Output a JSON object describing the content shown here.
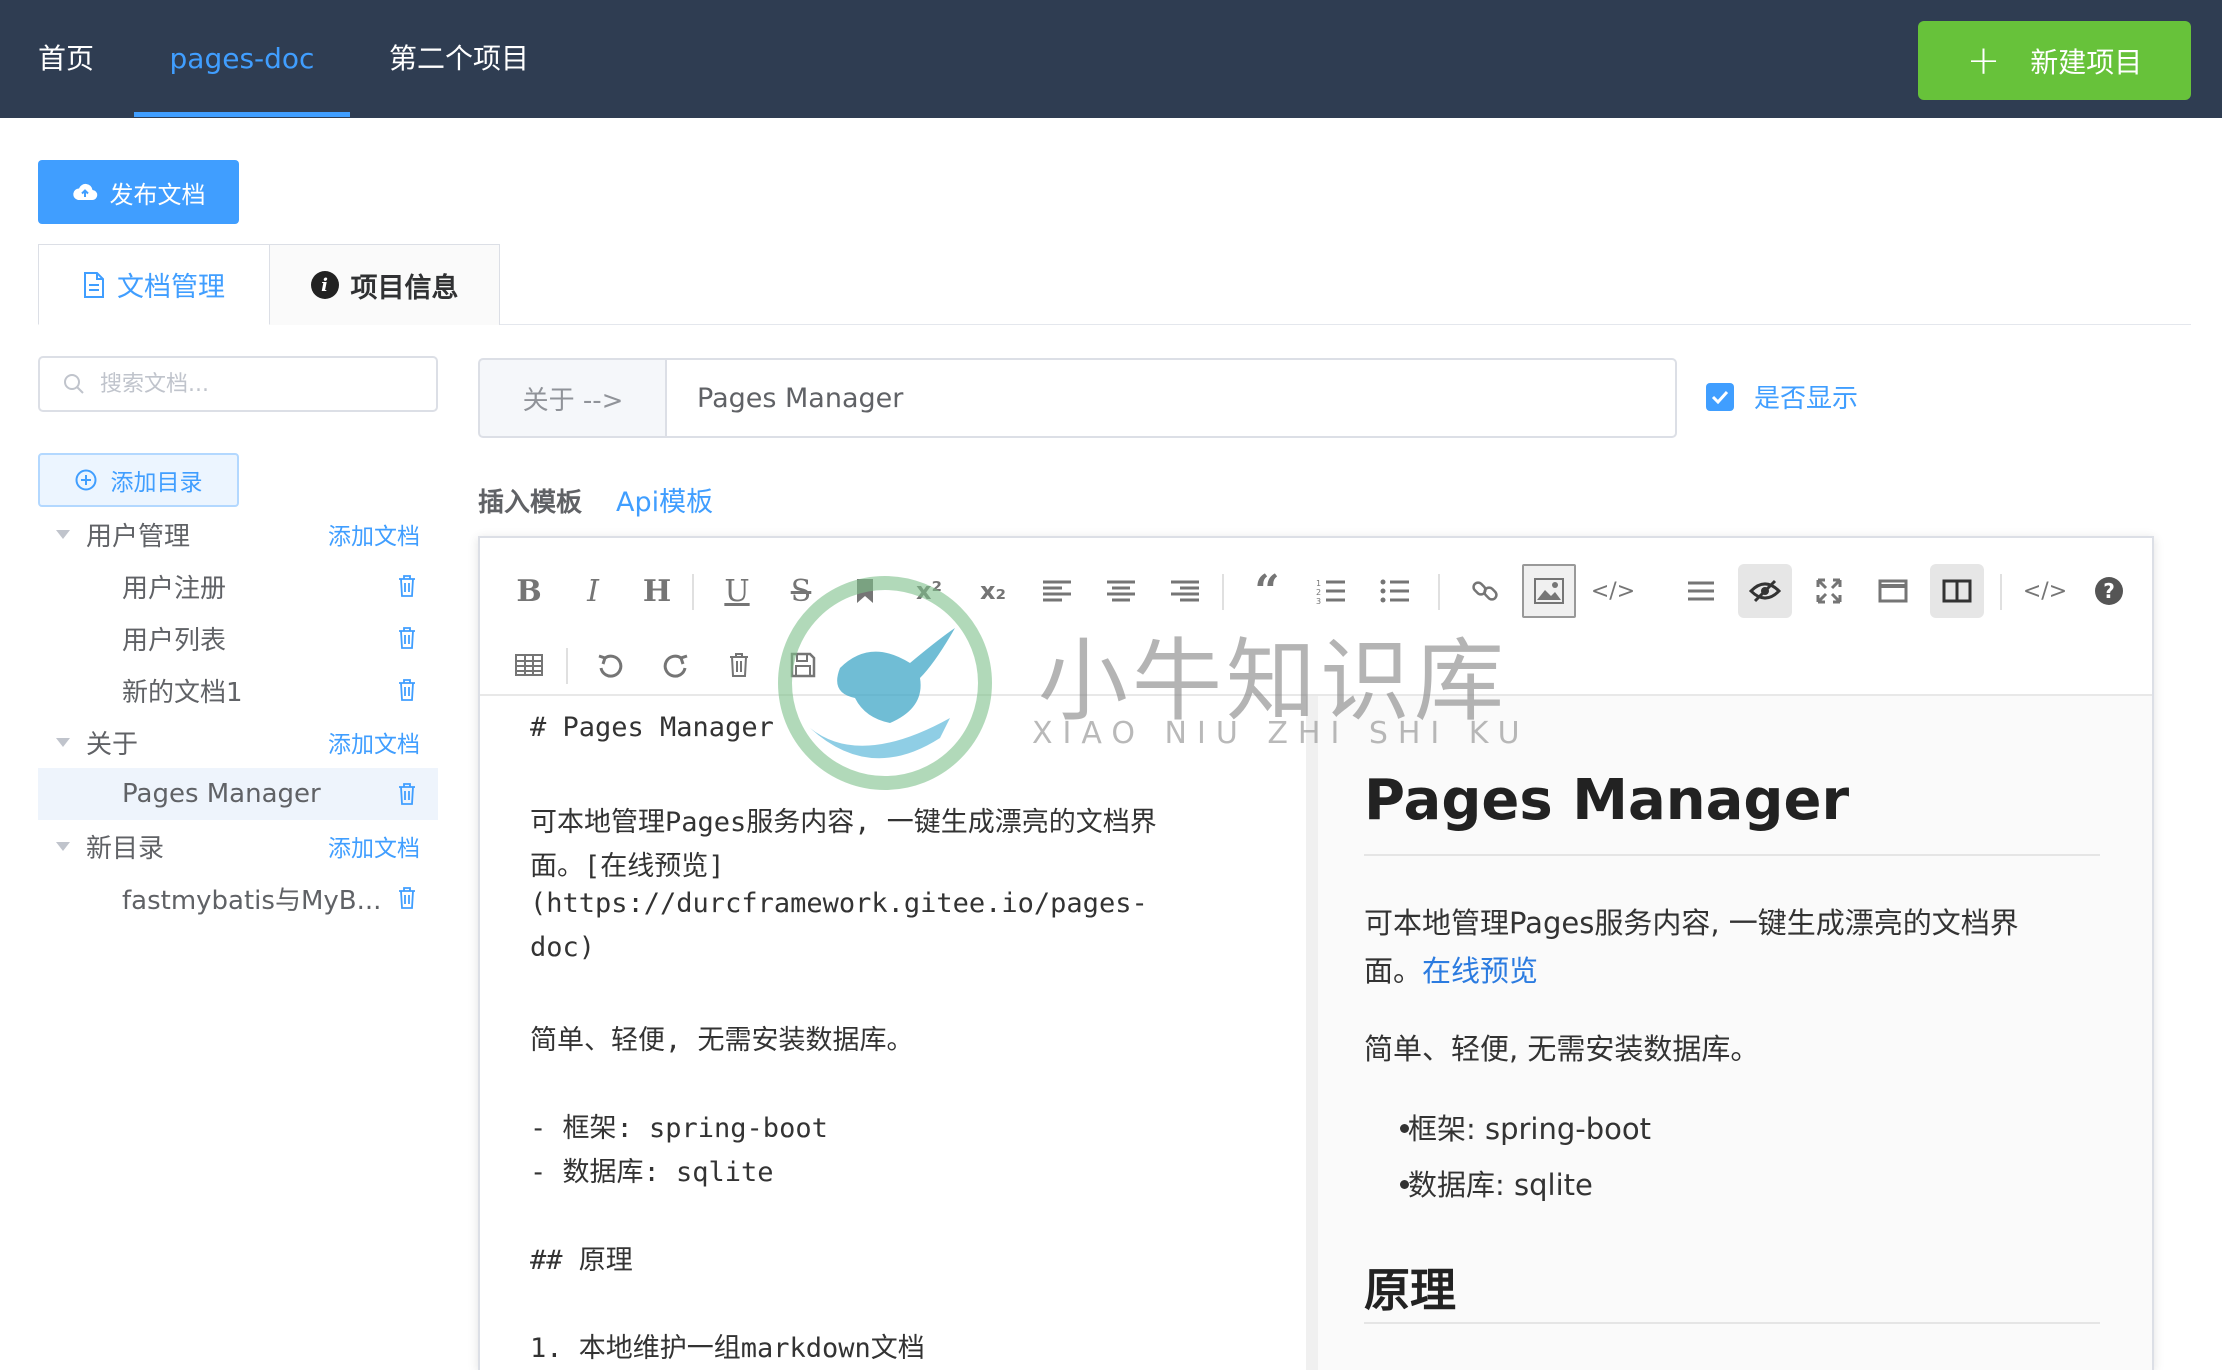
{
  "topnav": {
    "items": [
      "首页",
      "pages-doc",
      "第二个项目"
    ],
    "new_project_label": "新建项目"
  },
  "publish_label": "发布文档",
  "tabs": [
    "文档管理",
    "项目信息"
  ],
  "sidebar": {
    "search_placeholder": "搜索文档...",
    "add_dir_label": "添加目录",
    "add_doc_label": "添加文档",
    "groups": [
      {
        "label": "用户管理",
        "docs": [
          "用户注册",
          "用户列表",
          "新的文档1"
        ]
      },
      {
        "label": "关于",
        "docs": [
          "Pages Manager"
        ]
      },
      {
        "label": "新目录",
        "docs": [
          "fastmybatis与MyB..."
        ]
      }
    ]
  },
  "editor_title": {
    "prefix": "关于 -->",
    "value": "Pages Manager",
    "show_label": "是否显示",
    "show_checked": true
  },
  "insert": {
    "label": "插入模板",
    "link": "Api模板"
  },
  "source_lines": [
    "# Pages Manager",
    "",
    "可本地管理Pages服务内容, 一键生成漂亮的文档界",
    "面。[在线预览]",
    "(https://durcframework.gitee.io/pages-",
    "doc)",
    "",
    "简单、轻便, 无需安装数据库。",
    "",
    "- 框架: spring-boot",
    "- 数据库: sqlite",
    "",
    "## 原理",
    "",
    "1. 本地维护一组markdown文档"
  ],
  "preview": {
    "h1": "Pages Manager",
    "p1_line1": "可本地管理Pages服务内容, 一键生成漂亮的文档界",
    "p1_line2_prefix": "面。",
    "p1_link": "在线预览",
    "p2": "简单、轻便, 无需安装数据库。",
    "list": [
      "框架: spring-boot",
      "数据库: sqlite"
    ],
    "h2": "原理"
  },
  "watermark": {
    "text": "小牛知识库",
    "sub": "XIAO NIU ZHI SHI KU"
  },
  "colors": {
    "nav_bg": "#2f3d52",
    "primary": "#409eff",
    "success": "#67c23a"
  }
}
